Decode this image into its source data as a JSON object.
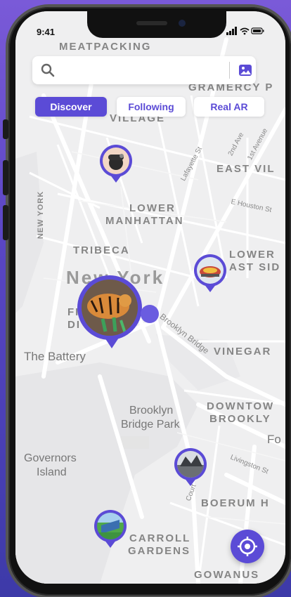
{
  "status_bar": {
    "time": "9:41",
    "icons": "▮▮▮ ◠ ▬"
  },
  "search": {
    "placeholder": "",
    "value": ""
  },
  "tabs": [
    {
      "label": "Discover",
      "active": true
    },
    {
      "label": "Following",
      "active": false
    },
    {
      "label": "Real AR",
      "active": false
    }
  ],
  "map_labels": {
    "meatpacking": "MEATPACKING",
    "gramercy": "GRAMERCY P",
    "greenwich": "VILLAGE",
    "east_village": "EAST VIL",
    "lower": "LOWER",
    "manhattan": "MANHATTAN",
    "tribeca": "TRIBECA",
    "lower_east_1": "LOWER",
    "lower_east_2": "AST SID",
    "new_york_city": "New York",
    "fi": "FI",
    "di": "DI",
    "the_battery": "The Battery",
    "vinegar": "VINEGAR",
    "brooklyn_bridge_park_1": "Brooklyn",
    "brooklyn_bridge_park_2": "Bridge Park",
    "downtown_1": "DOWNTOW",
    "downtown_2": "BROOKLY",
    "governors_1": "Governors",
    "governors_2": "Island",
    "boerum": "BOERUM H",
    "carroll_1": "CARROLL",
    "carroll_2": "GARDENS",
    "gowanus": "GOWANUS",
    "new_york_side": "NEW YORK",
    "lafayette": "Lafayette St",
    "second_ave": "2nd Ave",
    "first_ave": "1st Avenue",
    "e_houston": "E Houston St",
    "brooklyn_bridge": "Brooklyn Bridge",
    "livingston": "Livingston St",
    "court": "Court",
    "fo": "Fo"
  },
  "colors": {
    "accent": "#5b4bd6",
    "map_bg": "#efeff0",
    "road": "#ffffff",
    "water": "#e6e6e8"
  }
}
